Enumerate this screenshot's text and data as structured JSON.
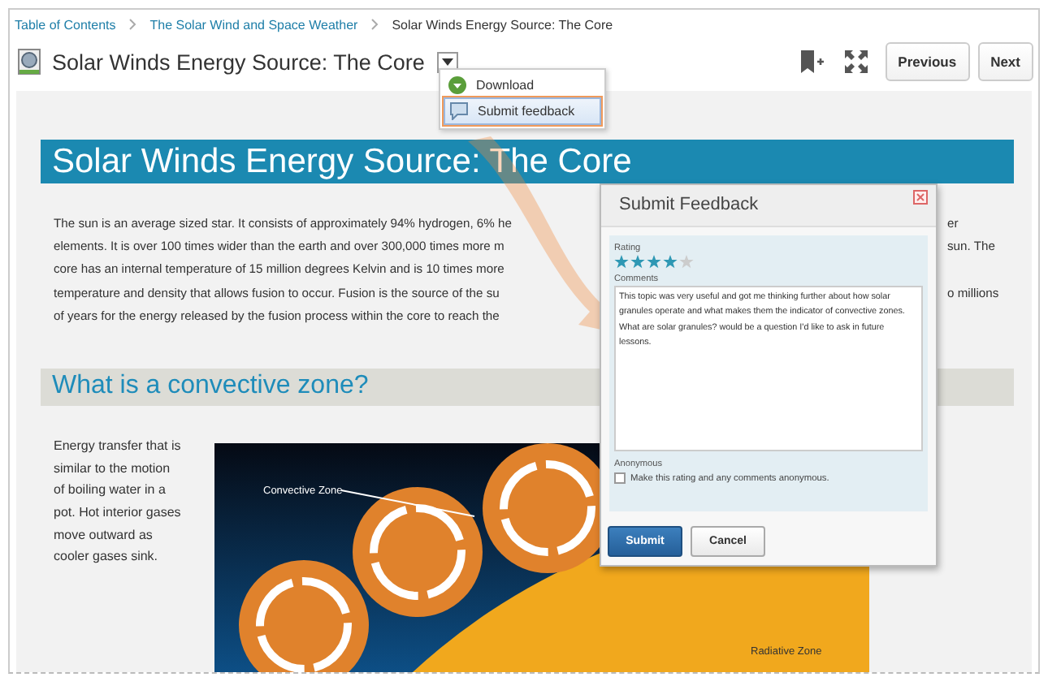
{
  "breadcrumb": [
    {
      "label": "Table of Contents"
    },
    {
      "label": "The Solar Wind and Space Weather"
    },
    {
      "label": "Solar Winds Energy Source: The Core"
    }
  ],
  "page_title": "Solar Winds Energy Source: The Core",
  "nav_buttons": [
    "Previous",
    "Next"
  ],
  "menu": {
    "items": [
      {
        "label": "Download",
        "kind": "download",
        "selected": false
      },
      {
        "label": "Submit feedback",
        "kind": "feedback",
        "selected": true
      }
    ]
  },
  "content": {
    "heading": "Solar Winds Energy Source: The Core",
    "paragraph_lines": [
      {
        "left": "The sun is an average sized star. It consists of approximately 94% hydrogen, 6% he",
        "right": "er"
      },
      {
        "left": "elements. It is over 100 times wider than the earth and over 300,000 times more m",
        "right": "sun. The"
      },
      {
        "left": "core has an internal temperature of 15 million degrees Kelvin and is 10 times more"
      },
      {
        "left": "temperature and density that allows fusion to occur. Fusion is the source of the su",
        "right": "o millions"
      },
      {
        "left": "of years for the energy released by the fusion process within the core to reach the"
      }
    ],
    "section_heading": "What is a convective zone?",
    "side_text": "Energy transfer that is similar to the motion of boiling water in a pot. Hot interior gases move outward as cooler gases sink.",
    "figure": {
      "labels": [
        "Convective Zone",
        "Radiative Zone"
      ]
    }
  },
  "dialog": {
    "title": "Submit Feedback",
    "rating_label": "Rating",
    "stars": 4,
    "comments_label": "Comments",
    "comments": "This topic was very useful and got me thinking further about how solar granules operate and what makes them the indicator of convective zones. What are solar granules? would be a question I'd like to ask in future lessons.",
    "anonymous_label": "Anonymous",
    "anonymous_checkbox": {
      "label": "Make this rating and any comments anonymous.",
      "checked": false
    },
    "buttons": [
      {
        "label": "Submit",
        "kind": "primary"
      },
      {
        "label": "Cancel",
        "kind": "secondary"
      }
    ]
  }
}
